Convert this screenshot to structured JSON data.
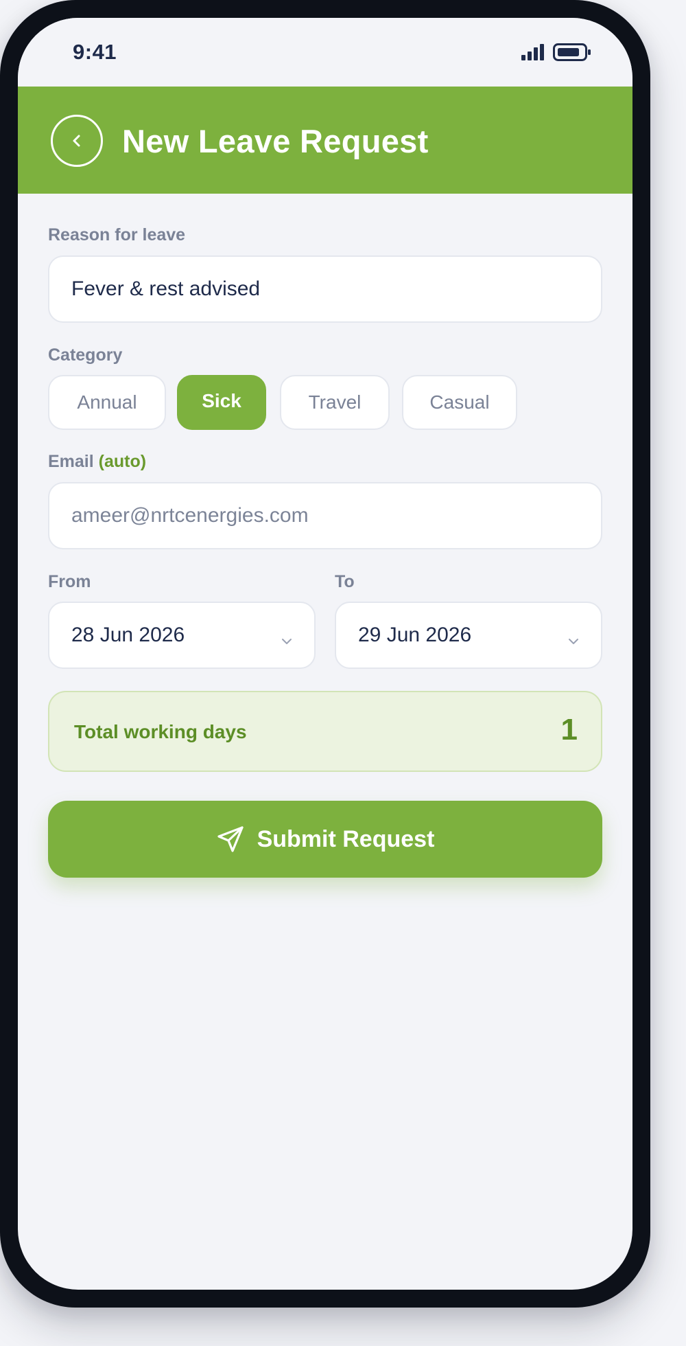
{
  "status_bar": {
    "time": "9:41"
  },
  "header": {
    "title": "New Leave Request",
    "back_icon": "chevron-left-icon"
  },
  "form": {
    "reason": {
      "label": "Reason for leave",
      "value": "Fever & rest advised"
    },
    "category": {
      "label": "Category",
      "options": [
        "Annual",
        "Sick",
        "Travel",
        "Casual"
      ],
      "selected": "Sick"
    },
    "email": {
      "label": "Email",
      "label_suffix": "(auto)",
      "placeholder": "ameer@nrtcenergies.com"
    },
    "from": {
      "label": "From",
      "value": "28 Jun 2026"
    },
    "to": {
      "label": "To",
      "value": "29 Jun 2026"
    },
    "summary": {
      "label": "Total working days",
      "value": "1"
    },
    "submit": {
      "label": "Submit Request",
      "icon": "send-icon"
    }
  },
  "colors": {
    "accent": "#7db13e",
    "accent_dark": "#5c8e26",
    "text_primary": "#1e2a4a",
    "text_muted": "#7a8296",
    "background": "#f3f4f8",
    "device_frame": "#0d1119"
  }
}
